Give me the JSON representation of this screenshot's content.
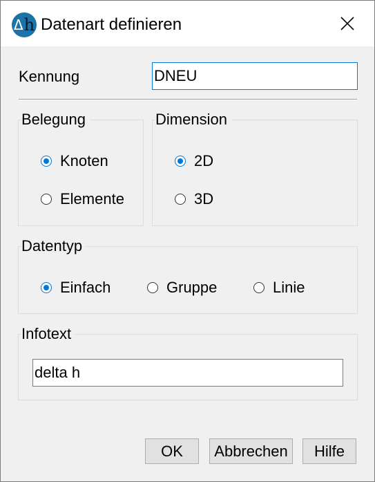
{
  "window": {
    "title": "Datenart definieren",
    "icon": "delta-h-app-icon",
    "icon_glyphs": {
      "delta": "Δ",
      "h": "h"
    }
  },
  "kennung": {
    "label": "Kennung",
    "value": "DNEU"
  },
  "belegung": {
    "title": "Belegung",
    "options": [
      {
        "label": "Knoten",
        "checked": true
      },
      {
        "label": "Elemente",
        "checked": false
      }
    ]
  },
  "dimension": {
    "title": "Dimension",
    "options": [
      {
        "label": "2D",
        "checked": true
      },
      {
        "label": "3D",
        "checked": false
      }
    ]
  },
  "datentyp": {
    "title": "Datentyp",
    "options": [
      {
        "label": "Einfach",
        "checked": true
      },
      {
        "label": "Gruppe",
        "checked": false
      },
      {
        "label": "Linie",
        "checked": false
      }
    ]
  },
  "infotext": {
    "title": "Infotext",
    "value": "delta h"
  },
  "buttons": {
    "ok": "OK",
    "cancel": "Abbrechen",
    "help": "Hilfe"
  },
  "colors": {
    "accent": "#0078d7",
    "icon_bg": "#1b73a8",
    "window_bg": "#f0f0f0"
  }
}
